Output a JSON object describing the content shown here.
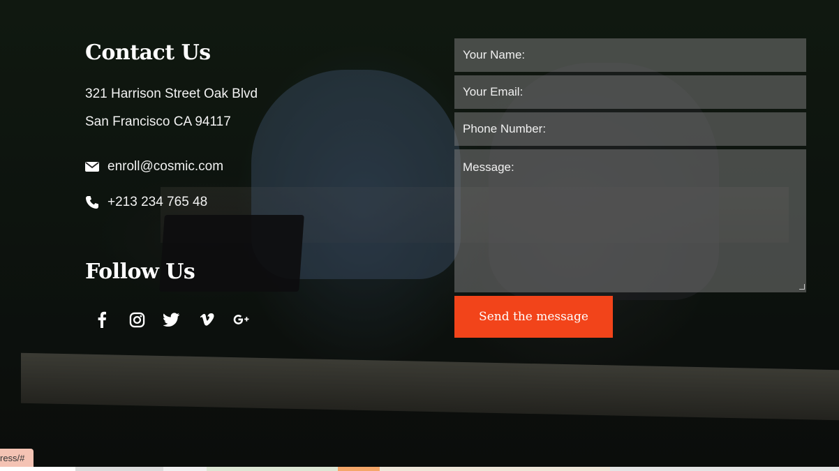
{
  "contact": {
    "title": "Contact Us",
    "address_line1": "321 Harrison Street Oak Blvd",
    "address_line2": "San Francisco CA 94117",
    "email": "enroll@cosmic.com",
    "phone": "+213 234 765 48"
  },
  "follow": {
    "title": "Follow Us",
    "icons": [
      "facebook-icon",
      "instagram-icon",
      "twitter-icon",
      "vimeo-icon",
      "google-plus-icon"
    ]
  },
  "form": {
    "name_placeholder": "Your Name:",
    "email_placeholder": "Your Email:",
    "phone_placeholder": "Phone Number:",
    "message_placeholder": "Message:",
    "submit_label": "Send the message"
  },
  "status_bar": {
    "url_fragment": "ress/#"
  },
  "colors": {
    "accent": "#f2441a",
    "field_bg": "rgba(120,120,120,0.55)",
    "text": "#ffffff"
  }
}
